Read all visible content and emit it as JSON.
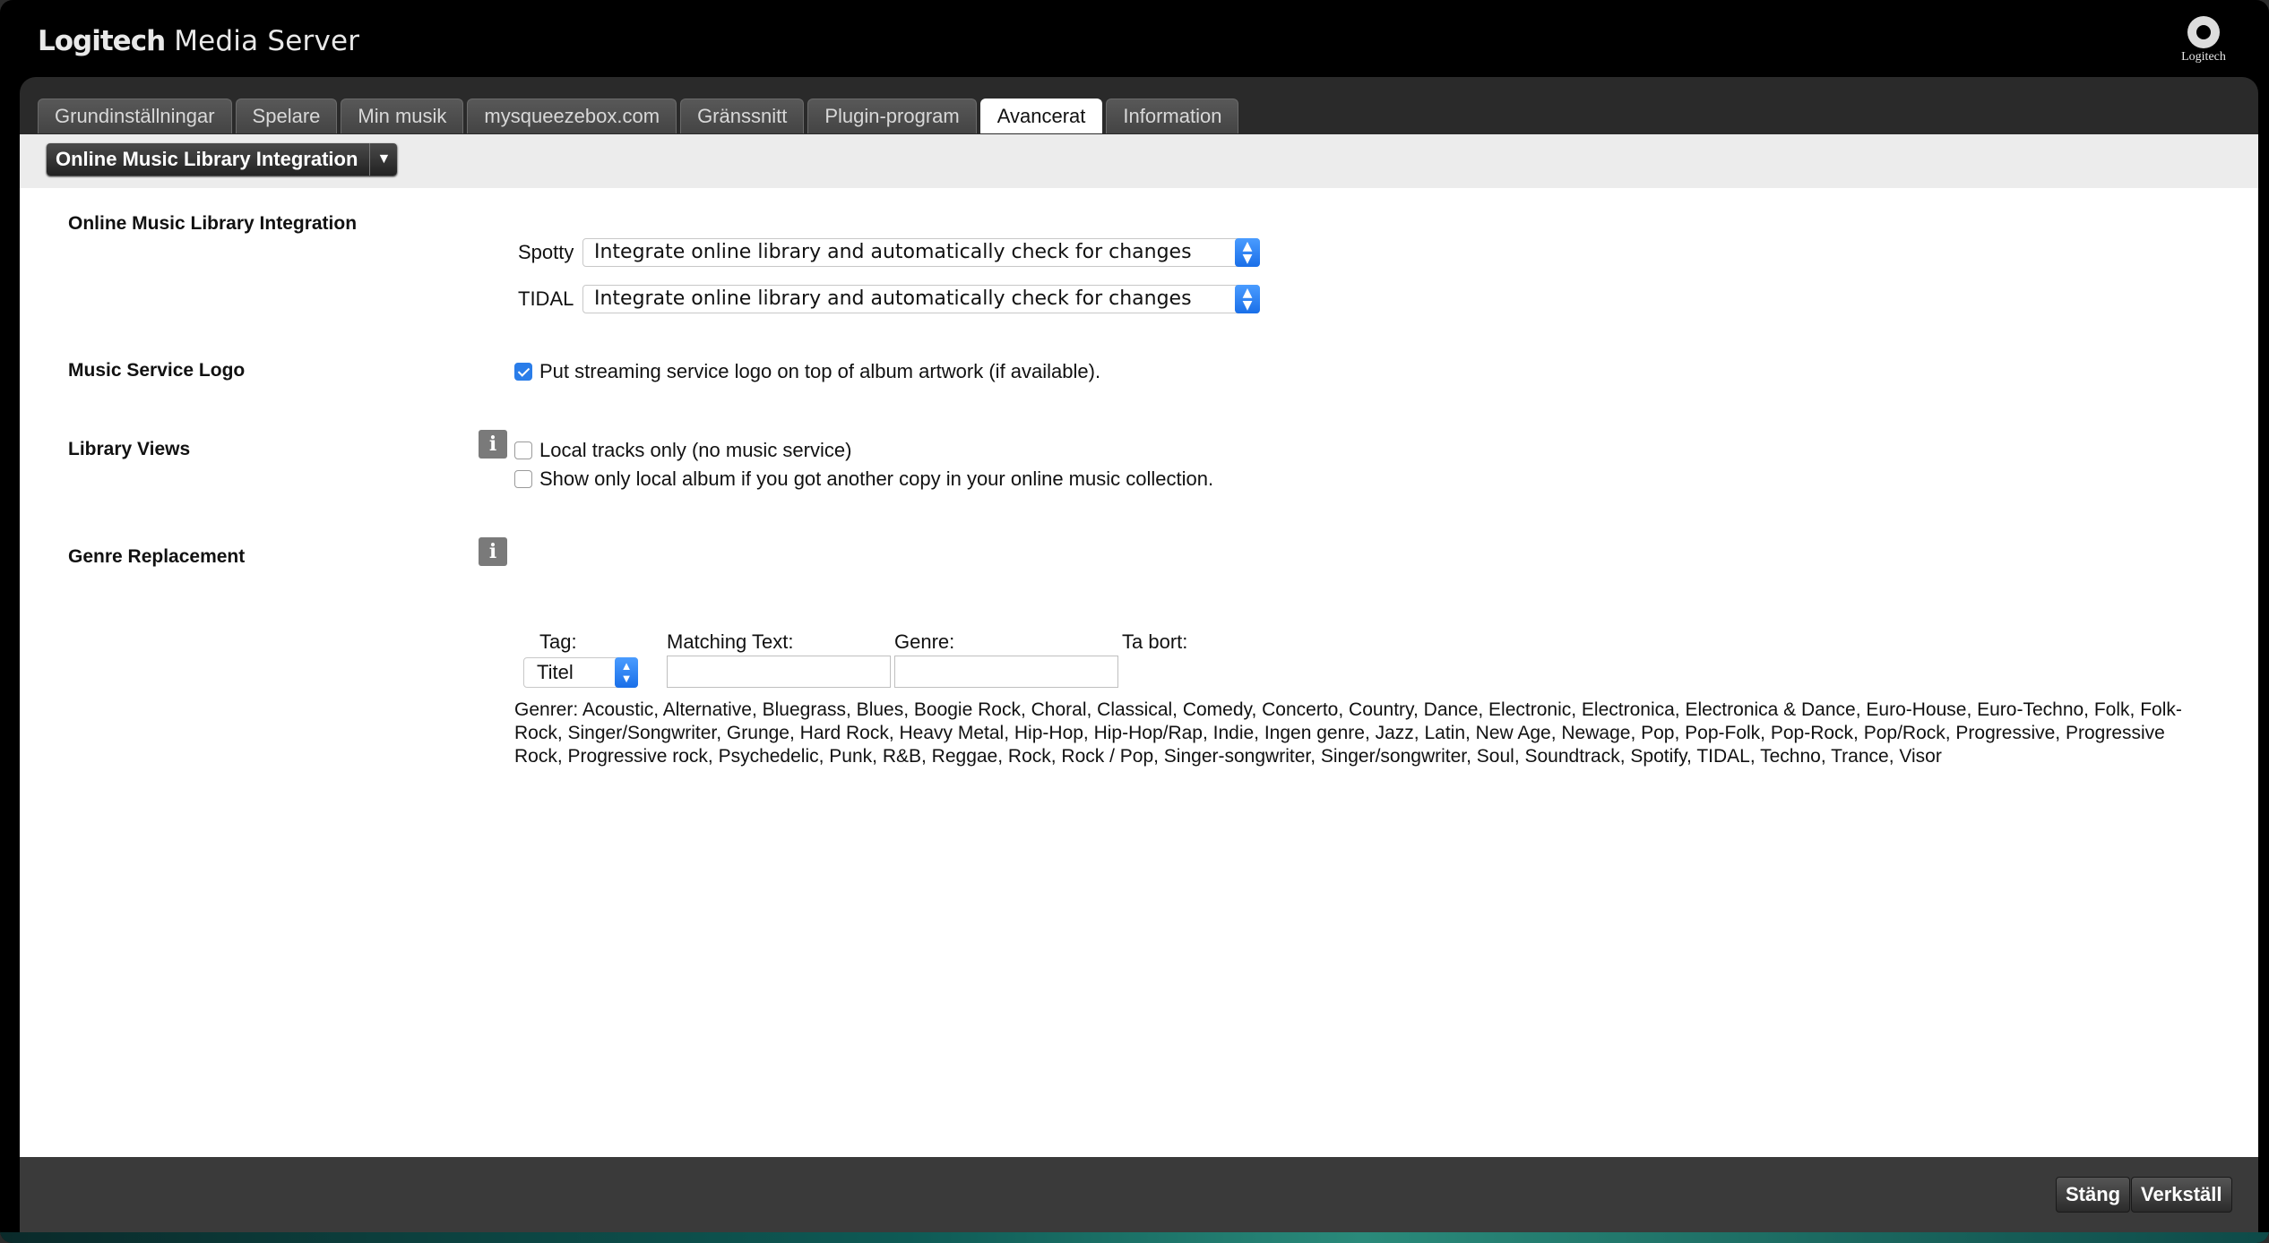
{
  "app": {
    "title_brand": "Logitech",
    "title_rest": " Media Server",
    "logo_text": "Logitech"
  },
  "tabs": [
    {
      "label": "Grundinställningar"
    },
    {
      "label": "Spelare"
    },
    {
      "label": "Min musik"
    },
    {
      "label": "mysqueezebox.com"
    },
    {
      "label": "Gränssnitt"
    },
    {
      "label": "Plugin-program"
    },
    {
      "label": "Avancerat",
      "active": true
    },
    {
      "label": "Information"
    }
  ],
  "section_dropdown": {
    "value": "Online Music Library Integration"
  },
  "omli": {
    "label": "Online Music Library Integration",
    "services": [
      {
        "name": "Spotty",
        "value": "Integrate online library and automatically check for changes"
      },
      {
        "name": "TIDAL",
        "value": "Integrate online library and automatically check for changes"
      }
    ]
  },
  "logo_setting": {
    "label": "Music Service Logo",
    "checkbox_label": "Put streaming service logo on top of album artwork (if available).",
    "checked": true
  },
  "library_views": {
    "label": "Library Views",
    "options": [
      {
        "label": "Local tracks only (no music service)",
        "checked": false
      },
      {
        "label": "Show only local album if you got another copy in your online music collection.",
        "checked": false
      }
    ]
  },
  "genre_replacement": {
    "label": "Genre Replacement",
    "col_tag": "Tag:",
    "col_matching": "Matching Text:",
    "col_genre": "Genre:",
    "col_delete": "Ta bort:",
    "tag_value": "Titel",
    "matching_value": "",
    "genre_value": "",
    "genres_text": "Genrer: Acoustic, Alternative, Bluegrass, Blues, Boogie Rock, Choral, Classical, Comedy, Concerto, Country, Dance, Electronic, Electronica, Electronica & Dance, Euro-House, Euro-Techno, Folk, Folk-Rock, Singer/Songwriter, Grunge, Hard Rock, Heavy Metal, Hip-Hop, Hip-Hop/Rap, Indie, Ingen genre, Jazz, Latin, New Age, Newage, Pop, Pop-Folk, Pop-Rock, Pop/Rock, Progressive, Progressive Rock, Progressive rock, Psychedelic, Punk, R&B, Reggae, Rock, Rock / Pop, Singer-songwriter, Singer/songwriter, Soul, Soundtrack, Spotify, TIDAL, Techno, Trance, Visor"
  },
  "footer": {
    "close_label": "Stäng",
    "apply_label": "Verkställ"
  },
  "colors": {
    "accent": "#2a7de9",
    "header_bg": "#000000",
    "panel_bg": "#2a2a2a"
  }
}
